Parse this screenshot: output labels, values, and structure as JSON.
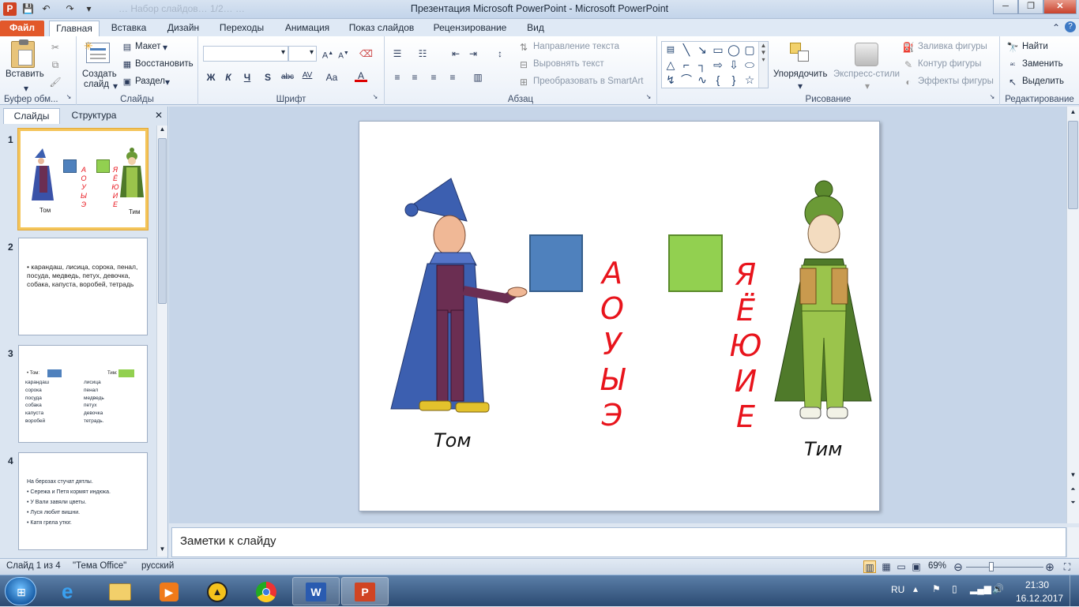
{
  "window": {
    "title": "Презентация Microsoft PowerPoint  -  Microsoft PowerPoint",
    "faded_hint": "… Набор слайдов… 1/2… …"
  },
  "tabs": [
    "Файл",
    "Главная",
    "Вставка",
    "Дизайн",
    "Переходы",
    "Анимация",
    "Показ слайдов",
    "Рецензирование",
    "Вид"
  ],
  "ribbon": {
    "clipboard": {
      "paste": "Вставить",
      "label": "Буфер обм..."
    },
    "slides": {
      "new_slide": "Создать",
      "new_slide2": "слайд",
      "layout": "Макет",
      "reset": "Восстановить",
      "section": "Раздел",
      "label": "Слайды"
    },
    "font": {
      "label": "Шрифт",
      "bold": "Ж",
      "italic": "К",
      "underline": "Ч",
      "shadow": "S",
      "strike": "abc",
      "spacing": "AV",
      "case": "Aa",
      "color": "A"
    },
    "paragraph": {
      "text_direction": "Направление текста",
      "align_text": "Выровнять текст",
      "smartart": "Преобразовать в SmartArt",
      "label": "Абзац"
    },
    "drawing": {
      "arrange": "Упорядочить",
      "quick_styles": "Экспресс-стили",
      "fill": "Заливка фигуры",
      "outline": "Контур фигуры",
      "effects": "Эффекты фигуры",
      "label": "Рисование"
    },
    "editing": {
      "find": "Найти",
      "replace": "Заменить",
      "select": "Выделить",
      "label": "Редактирование"
    }
  },
  "pane": {
    "tab_slides": "Слайды",
    "tab_outline": "Структура",
    "close": "✕",
    "thumbs": [
      {
        "num": "1",
        "left_name": "Том",
        "right_name": "Тим",
        "left_letters": [
          "А",
          "О",
          "У",
          "Ы",
          "Э"
        ],
        "right_letters": [
          "Я",
          "Ё",
          "Ю",
          "И",
          "Е"
        ]
      },
      {
        "num": "2",
        "text": "• карандаш, лисица, сорока, пенал, посуда, медведь, петух, девочка, собака, капуста, воробей, тетрадь"
      },
      {
        "num": "3",
        "head_left": "• Том:",
        "head_right": "Тим:",
        "col1": [
          "карандаш",
          "сорока",
          "посуда",
          "собака",
          "капуста",
          "воробей"
        ],
        "col2": [
          "лисица",
          "пенал",
          "медведь",
          "петух",
          "девочка",
          "тетрадь."
        ]
      },
      {
        "num": "4",
        "lines": [
          "На берозах стучат дятлы.",
          "• Сережа и Петя кормят индюка.",
          "• У Вали завяли цветы.",
          "• Луся любит вишни.",
          "• Катя грела утюг."
        ]
      }
    ]
  },
  "slide": {
    "left_name": "Том",
    "right_name": "Тим",
    "left_letters": [
      "А",
      "О",
      "У",
      "Ы",
      "Э"
    ],
    "right_letters": [
      "Я",
      "Ё",
      "Ю",
      "И",
      "Е"
    ],
    "colors": {
      "blue": "#4f81bd",
      "green": "#92d050",
      "red": "#e8141c"
    }
  },
  "notes": {
    "placeholder": "Заметки к слайду"
  },
  "status": {
    "slide": "Слайд 1 из 4",
    "theme": "\"Тема Office\"",
    "lang": "русский",
    "zoom": "69%",
    "zoom_value": 0.69
  },
  "taskbar": {
    "lang": "RU",
    "time": "21:30",
    "date": "16.12.2017"
  }
}
